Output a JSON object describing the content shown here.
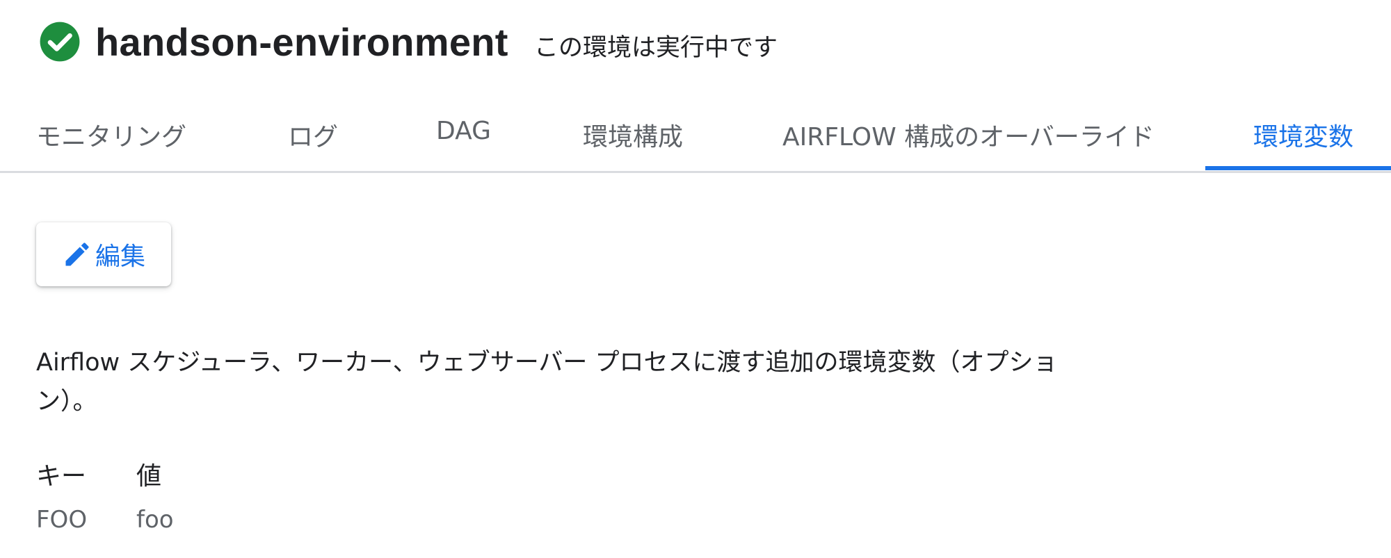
{
  "header": {
    "title": "handson-environment",
    "status_text": "この環境は実行中です",
    "status_icon": "check-circle-icon",
    "status_color": "#1e8e3e"
  },
  "tabs": [
    {
      "label": "モニタリング",
      "active": false
    },
    {
      "label": "ログ",
      "active": false
    },
    {
      "label": "DAG",
      "active": false
    },
    {
      "label": "環境構成",
      "active": false
    },
    {
      "label": "AIRFLOW 構成のオーバーライド",
      "active": false
    },
    {
      "label": "環境変数",
      "active": true
    }
  ],
  "toolbar": {
    "edit_label": "編集",
    "edit_icon": "pencil-icon"
  },
  "description": "Airflow スケジューラ、ワーカー、ウェブサーバー プロセスに渡す追加の環境変数（オプション）。",
  "env_vars": {
    "headers": {
      "key": "キー",
      "value": "値"
    },
    "rows": [
      {
        "key": "FOO",
        "value": "foo"
      }
    ]
  },
  "colors": {
    "accent": "#1a73e8",
    "tab_text": "#5f6368",
    "divider": "#dadce0"
  }
}
